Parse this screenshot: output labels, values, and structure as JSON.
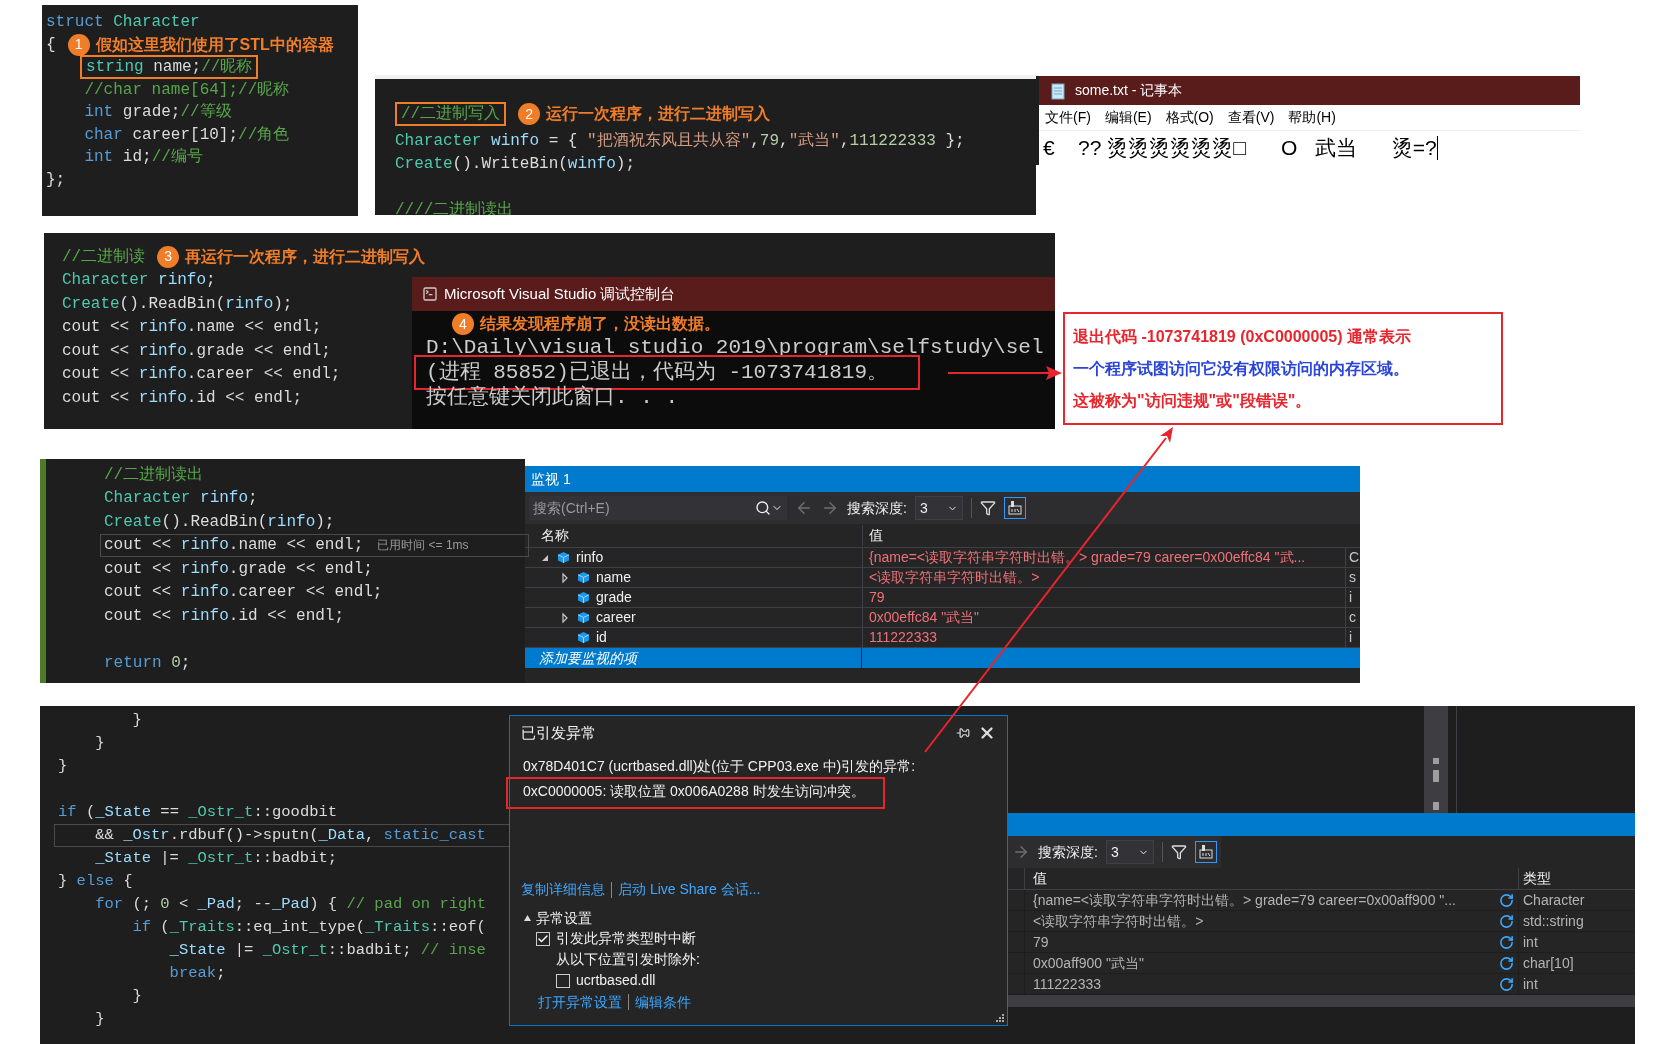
{
  "struct_snippet": {
    "lines": [
      {
        "kind": "code",
        "tokens": [
          {
            "kind": "kw",
            "text": "struct"
          },
          {
            "kind": "type",
            "text": " Character"
          }
        ]
      },
      {
        "kind": "code",
        "tokens": [
          {
            "kind": "pl",
            "text": "{"
          }
        ],
        "callout": {
          "number": "1",
          "text": "假如这里我们使用了STL中的容器"
        }
      },
      {
        "kind": "code",
        "indented": true,
        "boxed_tokens": [
          {
            "kind": "type",
            "text": "string"
          },
          {
            "kind": "pl",
            "text": " name;"
          },
          {
            "kind": "cm",
            "text": "//昵称"
          }
        ]
      },
      {
        "kind": "code",
        "tokens": [
          {
            "kind": "cm",
            "text": "    //char name[64];//昵称"
          }
        ]
      },
      {
        "kind": "code",
        "tokens": [
          {
            "kind": "kw",
            "text": "    int"
          },
          {
            "kind": "pl",
            "text": " grade;"
          },
          {
            "kind": "cm",
            "text": "//等级"
          }
        ]
      },
      {
        "kind": "code",
        "tokens": [
          {
            "kind": "kw",
            "text": "    char"
          },
          {
            "kind": "pl",
            "text": " career[10];"
          },
          {
            "kind": "cm",
            "text": "//角色"
          }
        ]
      },
      {
        "kind": "code",
        "tokens": [
          {
            "kind": "kw",
            "text": "    int"
          },
          {
            "kind": "pl",
            "text": " id;"
          },
          {
            "kind": "cm",
            "text": "//编号"
          }
        ]
      },
      {
        "kind": "code",
        "tokens": [
          {
            "kind": "pl",
            "text": "};"
          }
        ]
      }
    ]
  },
  "write_snippet": {
    "lines": [
      {
        "kind": "code",
        "boxed_tokens": [
          {
            "kind": "cm",
            "text": "//二进制写入"
          }
        ],
        "callout": {
          "number": "2",
          "text": "运行一次程序，进行二进制写入"
        }
      },
      {
        "kind": "code",
        "tokens": [
          {
            "kind": "type",
            "text": "Character"
          },
          {
            "kind": "var",
            "text": " winfo"
          },
          {
            "kind": "pl",
            "text": " = { "
          },
          {
            "kind": "str",
            "text": "\"把酒祝东风且共从容\""
          },
          {
            "kind": "pl",
            "text": ","
          },
          {
            "kind": "num",
            "text": "79"
          },
          {
            "kind": "pl",
            "text": ","
          },
          {
            "kind": "str",
            "text": "\"武当\""
          },
          {
            "kind": "pl",
            "text": ","
          },
          {
            "kind": "num",
            "text": "111222333"
          },
          {
            "kind": "pl",
            "text": " };"
          }
        ]
      },
      {
        "kind": "code",
        "tokens": [
          {
            "kind": "type",
            "text": "Create"
          },
          {
            "kind": "pl",
            "text": "().WriteBin("
          },
          {
            "kind": "var",
            "text": "winfo"
          },
          {
            "kind": "pl",
            "text": ");"
          }
        ]
      },
      {
        "kind": "blank"
      },
      {
        "kind": "code",
        "tokens": [
          {
            "kind": "cm",
            "text": "////二进制读出"
          }
        ]
      }
    ]
  },
  "notepad": {
    "title": "some.txt - 记事本",
    "menu": [
      "文件(F)",
      "编辑(E)",
      "格式(O)",
      "查看(V)",
      "帮助(H)"
    ],
    "content": "€    ?? 烫烫烫烫烫烫□      O   武当      烫=?"
  },
  "read_snippet": {
    "lines": [
      {
        "kind": "code",
        "tokens": [
          {
            "kind": "cm",
            "text": "//二进制读"
          }
        ],
        "callout": {
          "number": "3",
          "text": "再运行一次程序，进行二进制写入"
        }
      },
      {
        "kind": "code",
        "tokens": [
          {
            "kind": "type",
            "text": "Character"
          },
          {
            "kind": "var",
            "text": " rinfo"
          },
          {
            "kind": "pl",
            "text": ";"
          }
        ]
      },
      {
        "kind": "code",
        "tokens": [
          {
            "kind": "type",
            "text": "Create"
          },
          {
            "kind": "pl",
            "text": "().ReadBin("
          },
          {
            "kind": "var",
            "text": "rinfo"
          },
          {
            "kind": "pl",
            "text": ");"
          }
        ]
      },
      {
        "kind": "code",
        "tokens": [
          {
            "kind": "pl",
            "text": "cout << "
          },
          {
            "kind": "var",
            "text": "rinfo"
          },
          {
            "kind": "pl",
            "text": ".name << endl;"
          }
        ]
      },
      {
        "kind": "code",
        "tokens": [
          {
            "kind": "pl",
            "text": "cout << "
          },
          {
            "kind": "var",
            "text": "rinfo"
          },
          {
            "kind": "pl",
            "text": ".grade << endl;"
          }
        ]
      },
      {
        "kind": "code",
        "tokens": [
          {
            "kind": "pl",
            "text": "cout << "
          },
          {
            "kind": "var",
            "text": "rinfo"
          },
          {
            "kind": "pl",
            "text": ".career << endl;"
          }
        ]
      },
      {
        "kind": "code",
        "tokens": [
          {
            "kind": "pl",
            "text": "cout << "
          },
          {
            "kind": "var",
            "text": "rinfo"
          },
          {
            "kind": "pl",
            "text": ".id << endl;"
          }
        ]
      }
    ]
  },
  "console": {
    "title": "Microsoft Visual Studio 调试控制台",
    "callout": {
      "number": "4",
      "text": "结果发现程序崩了，没读出数据。"
    },
    "lines": [
      {
        "text": "D:\\Daily\\visual studio 2019\\program\\selfstudy\\sel",
        "boxed": false
      },
      {
        "text": "(进程 85852)已退出，代码为 -1073741819。",
        "boxed": true
      },
      {
        "text": "按任意键关闭此窗口. . .",
        "boxed": false
      }
    ]
  },
  "explanation": [
    {
      "text": "退出代码 -1073741819 (0xC0000005) 通常表示",
      "color": "#e8242c"
    },
    {
      "text": "一个程序试图访问它没有权限访问的内存区域。",
      "color": "#2a44d8"
    },
    {
      "text": "这被称为\"访问违规\"或\"段错误\"。",
      "color": "#e8242c"
    }
  ],
  "debug_snippet": {
    "lines": [
      {
        "kind": "code",
        "current": false,
        "tokens": [
          {
            "kind": "cm",
            "text": "//二进制读出"
          }
        ]
      },
      {
        "kind": "code",
        "current": false,
        "tokens": [
          {
            "kind": "type",
            "text": "Character"
          },
          {
            "kind": "var",
            "text": " rinfo"
          },
          {
            "kind": "pl",
            "text": ";"
          }
        ]
      },
      {
        "kind": "code",
        "current": false,
        "tokens": [
          {
            "kind": "type",
            "text": "Create"
          },
          {
            "kind": "pl",
            "text": "().ReadBin("
          },
          {
            "kind": "var",
            "text": "rinfo"
          },
          {
            "kind": "pl",
            "text": ");"
          }
        ]
      },
      {
        "kind": "code",
        "current": true,
        "tokens": [
          {
            "kind": "pl",
            "text": "cout << "
          },
          {
            "kind": "var",
            "text": "rinfo"
          },
          {
            "kind": "pl",
            "text": ".name << endl;"
          }
        ],
        "elapsed": "已用时间 <= 1ms"
      },
      {
        "kind": "code",
        "current": false,
        "tokens": [
          {
            "kind": "pl",
            "text": "cout << "
          },
          {
            "kind": "var",
            "text": "rinfo"
          },
          {
            "kind": "pl",
            "text": ".grade << endl;"
          }
        ]
      },
      {
        "kind": "code",
        "current": false,
        "tokens": [
          {
            "kind": "pl",
            "text": "cout << "
          },
          {
            "kind": "var",
            "text": "rinfo"
          },
          {
            "kind": "pl",
            "text": ".career << endl;"
          }
        ]
      },
      {
        "kind": "code",
        "current": false,
        "tokens": [
          {
            "kind": "pl",
            "text": "cout << "
          },
          {
            "kind": "var",
            "text": "rinfo"
          },
          {
            "kind": "pl",
            "text": ".id << endl;"
          }
        ]
      },
      {
        "kind": "blank"
      },
      {
        "kind": "code",
        "current": false,
        "tokens": [
          {
            "kind": "kw",
            "text": "return"
          },
          {
            "kind": "num",
            "text": " 0"
          },
          {
            "kind": "pl",
            "text": ";"
          }
        ]
      }
    ]
  },
  "watch": {
    "title": "监视 1",
    "search": {
      "placeholder": "搜索(Ctrl+E)"
    },
    "depth_label": "搜索深度:",
    "depth": "3",
    "columns": [
      "名称",
      "值"
    ],
    "rows": [
      {
        "name": "rinfo",
        "value": "{name=<读取字符串字符时出错。> grade=79 career=0x00effc84 \"武...",
        "type": "C",
        "expandable": true,
        "expanded": true,
        "changed": true,
        "children": [
          {
            "name": "name",
            "value": "<读取字符串字符时出错。>",
            "type": "s",
            "expandable": true,
            "expanded": false,
            "changed": true
          },
          {
            "name": "grade",
            "value": "79",
            "type": "i",
            "expandable": false,
            "changed": true
          },
          {
            "name": "career",
            "value": "0x00effc84 \"武当\"",
            "type": "c",
            "expandable": true,
            "expanded": false,
            "changed": true
          },
          {
            "name": "id",
            "value": "111222333",
            "type": "i",
            "expandable": false,
            "changed": true
          }
        ]
      }
    ],
    "add_row": {
      "text": "添加要监视的项",
      "selected": true
    }
  },
  "stl_snippet": {
    "lines": [
      {
        "kind": "code",
        "current": false,
        "tokens": [
          {
            "kind": "pl",
            "text": "        }"
          }
        ]
      },
      {
        "kind": "code",
        "current": false,
        "tokens": [
          {
            "kind": "pl",
            "text": "    }"
          }
        ]
      },
      {
        "kind": "code",
        "current": false,
        "tokens": [
          {
            "kind": "pl",
            "text": "}"
          }
        ]
      },
      {
        "kind": "blank"
      },
      {
        "kind": "code",
        "current": false,
        "tokens": [
          {
            "kind": "kw",
            "text": "if"
          },
          {
            "kind": "pl",
            "text": " ("
          },
          {
            "kind": "var",
            "text": "_State"
          },
          {
            "kind": "pl",
            "text": " == "
          },
          {
            "kind": "type",
            "text": "_Ostr_t"
          },
          {
            "kind": "pl",
            "text": "::goodbit"
          }
        ]
      },
      {
        "kind": "code",
        "current": true,
        "tokens": [
          {
            "kind": "pl",
            "text": "    && "
          },
          {
            "kind": "var",
            "text": "_Ostr"
          },
          {
            "kind": "pl",
            "text": ".rdbuf()->sputn("
          },
          {
            "kind": "var",
            "text": "_Data"
          },
          {
            "kind": "pl",
            "text": ", "
          },
          {
            "kind": "kw",
            "text": "static_cast"
          }
        ]
      },
      {
        "kind": "code",
        "current": false,
        "tokens": [
          {
            "kind": "var",
            "text": "    _State"
          },
          {
            "kind": "pl",
            "text": " |= "
          },
          {
            "kind": "type",
            "text": "_Ostr_t"
          },
          {
            "kind": "pl",
            "text": "::badbit;"
          }
        ]
      },
      {
        "kind": "code",
        "current": false,
        "tokens": [
          {
            "kind": "pl",
            "text": "} "
          },
          {
            "kind": "kw",
            "text": "else"
          },
          {
            "kind": "pl",
            "text": " {"
          }
        ]
      },
      {
        "kind": "code",
        "current": false,
        "tokens": [
          {
            "kind": "kw",
            "text": "    for"
          },
          {
            "kind": "pl",
            "text": " (; "
          },
          {
            "kind": "num",
            "text": "0"
          },
          {
            "kind": "pl",
            "text": " < "
          },
          {
            "kind": "var",
            "text": "_Pad"
          },
          {
            "kind": "pl",
            "text": "; --"
          },
          {
            "kind": "var",
            "text": "_Pad"
          },
          {
            "kind": "pl",
            "text": ") { "
          },
          {
            "kind": "cm",
            "text": "// pad on right"
          }
        ]
      },
      {
        "kind": "code",
        "current": false,
        "tokens": [
          {
            "kind": "kw",
            "text": "        if"
          },
          {
            "kind": "pl",
            "text": " ("
          },
          {
            "kind": "type",
            "text": "_Traits"
          },
          {
            "kind": "pl",
            "text": "::eq_int_type("
          },
          {
            "kind": "type",
            "text": "_Traits"
          },
          {
            "kind": "pl",
            "text": "::eof("
          }
        ]
      },
      {
        "kind": "code",
        "current": false,
        "tokens": [
          {
            "kind": "var",
            "text": "            _State"
          },
          {
            "kind": "pl",
            "text": " |= "
          },
          {
            "kind": "type",
            "text": "_Ostr_t"
          },
          {
            "kind": "pl",
            "text": "::badbit; "
          },
          {
            "kind": "cm",
            "text": "// inse"
          }
        ]
      },
      {
        "kind": "code",
        "current": false,
        "tokens": [
          {
            "kind": "kw",
            "text": "            break"
          },
          {
            "kind": "pl",
            "text": ";"
          }
        ]
      },
      {
        "kind": "code",
        "current": false,
        "tokens": [
          {
            "kind": "pl",
            "text": "        }"
          }
        ]
      },
      {
        "kind": "code",
        "current": false,
        "tokens": [
          {
            "kind": "pl",
            "text": "    }"
          }
        ]
      }
    ]
  },
  "exception_dialog": {
    "title": "已引发异常",
    "message": [
      {
        "text": "0x78D401C7 (ucrtbased.dll)处(位于 CPP03.exe 中)引发的异常:",
        "boxed": false
      },
      {
        "text": "0xC0000005: 读取位置 0x006A0288 时发生访问冲突。",
        "boxed": true
      }
    ],
    "links": [
      "复制详细信息",
      "启动 Live Share 会话..."
    ],
    "settings": {
      "title": "异常设置",
      "expanded": true,
      "break_option": {
        "label": "引发此异常类型时中断",
        "checked": true
      },
      "except_label": "从以下位置引发时除外:",
      "module_option": {
        "label": "ucrtbased.dll",
        "checked": false
      }
    },
    "bottom_links": [
      "打开异常设置",
      "编辑条件"
    ]
  },
  "watch_2": {
    "depth_label": "搜索深度:",
    "depth": "3",
    "columns": [
      "值",
      "类型"
    ],
    "rows": [
      {
        "value": "{name=<读取字符串字符时出错。> grade=79 career=0x00aff900 \"...",
        "type": "Character",
        "changed": false
      },
      {
        "value": "<读取字符串字符时出错。>",
        "type": "std::string",
        "changed": false
      },
      {
        "value": "79",
        "type": "int",
        "changed": false
      },
      {
        "value": "0x00aff900 \"武当\"",
        "type": "char[10]",
        "changed": false
      },
      {
        "value": "111222333",
        "type": "int",
        "changed": false
      }
    ]
  }
}
